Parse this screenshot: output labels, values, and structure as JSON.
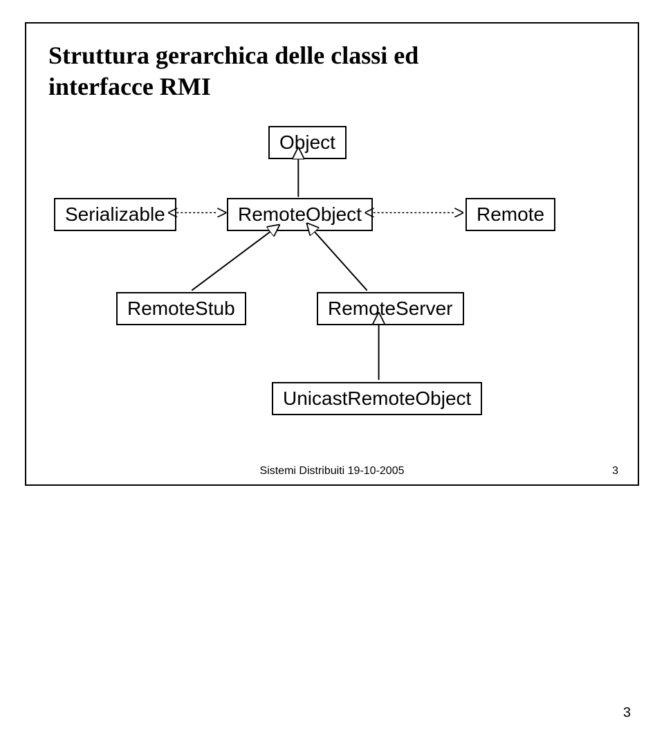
{
  "title_line1": "Struttura gerarchica delle classi ed",
  "title_line2": "interfacce RMI",
  "nodes": {
    "object": "Object",
    "serializable": "Serializable",
    "remoteobject": "RemoteObject",
    "remote": "Remote",
    "remotestub": "RemoteStub",
    "remoteserver": "RemoteServer",
    "unicast": "UnicastRemoteObject"
  },
  "footer_center": "Sistemi Distribuiti 19-10-2005",
  "footer_right": "3",
  "page_outside": "3"
}
